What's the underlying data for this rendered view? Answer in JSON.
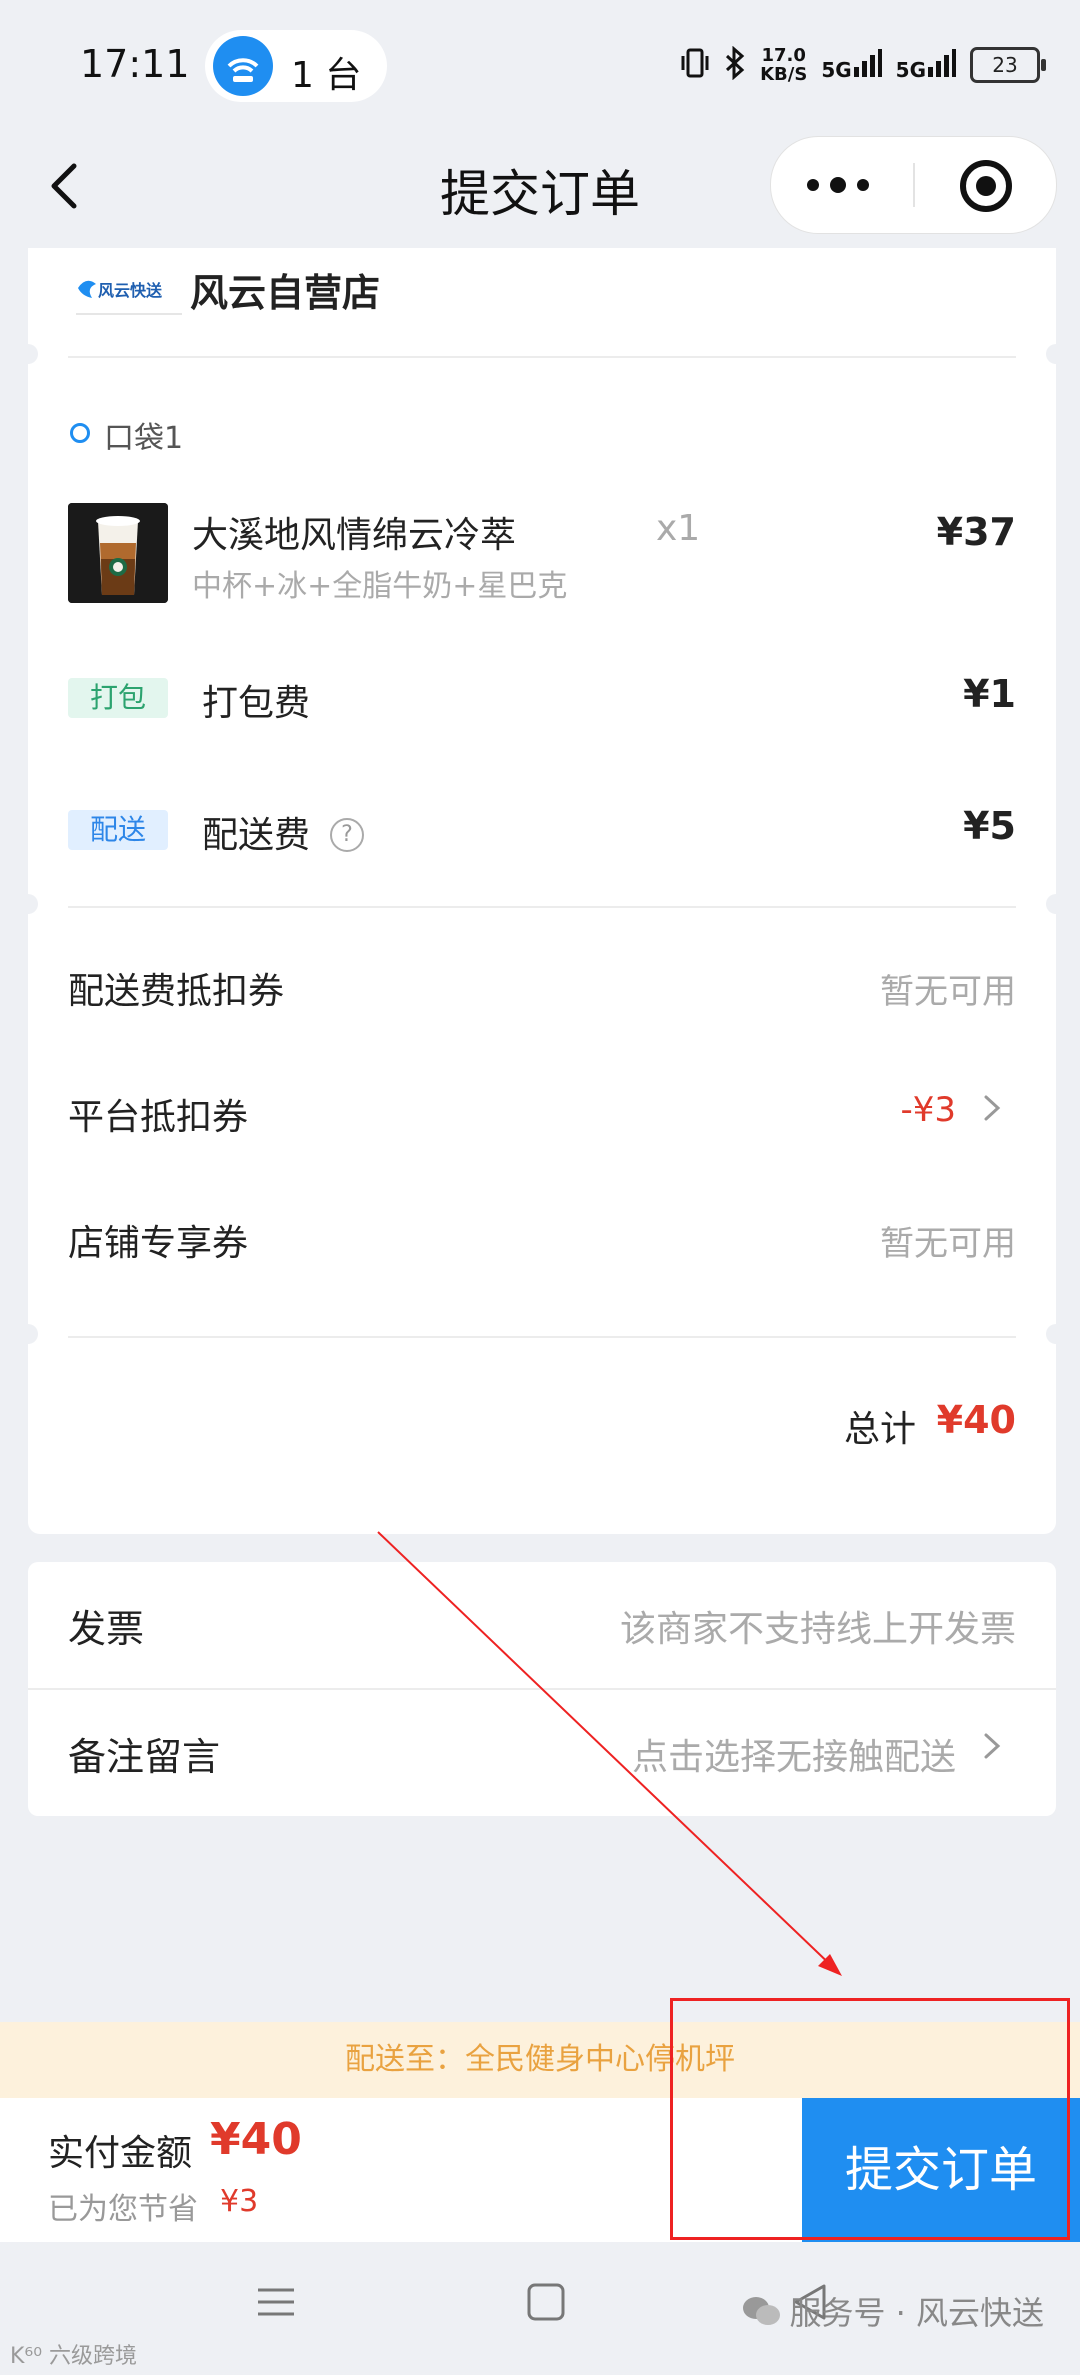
{
  "status_bar": {
    "time": "17:11",
    "hotspot_count": "1 台",
    "net_speed_value": "17.0",
    "net_speed_unit": "KB/S",
    "signal_1": "5G",
    "signal_2": "5G",
    "battery": "23"
  },
  "nav": {
    "title": "提交订单"
  },
  "shop": {
    "name": "风云自营店",
    "logo_text": "风云快送"
  },
  "bag": {
    "label": "口袋1"
  },
  "product": {
    "name": "大溪地风情绵云冷萃",
    "spec": "中杯+冰+全脂牛奶+星巴克",
    "qty": "x1",
    "price": "¥37"
  },
  "fees": [
    {
      "tag": "打包",
      "label": "打包费",
      "value": "¥1"
    },
    {
      "tag": "配送",
      "label": "配送费",
      "value": "¥5"
    }
  ],
  "coupons": [
    {
      "label": "配送费抵扣券",
      "value": "暂无可用"
    },
    {
      "label": "平台抵扣券",
      "value": "-¥3"
    },
    {
      "label": "店铺专享券",
      "value": "暂无可用"
    }
  ],
  "total": {
    "label": "总计",
    "value": "¥40"
  },
  "extras": {
    "invoice_label": "发票",
    "invoice_value": "该商家不支持线上开发票",
    "note_label": "备注留言",
    "note_value": "点击选择无接触配送"
  },
  "delivery": {
    "address": "配送至：全民健身中心停机坪"
  },
  "payment": {
    "label": "实付金额",
    "amount": "¥40",
    "saved_label": "已为您节省",
    "saved_amount": "¥3",
    "submit_label": "提交订单"
  },
  "watermarks": {
    "left": "K⁶⁰ 六级跨境",
    "right": "服务号 · 风云快送"
  },
  "colors": {
    "accent": "#1f8ef1",
    "price_red": "#e03a2b",
    "address_bg": "#fdf1dc",
    "address_text": "#e9a240",
    "annotation_red": "#ee2222"
  }
}
